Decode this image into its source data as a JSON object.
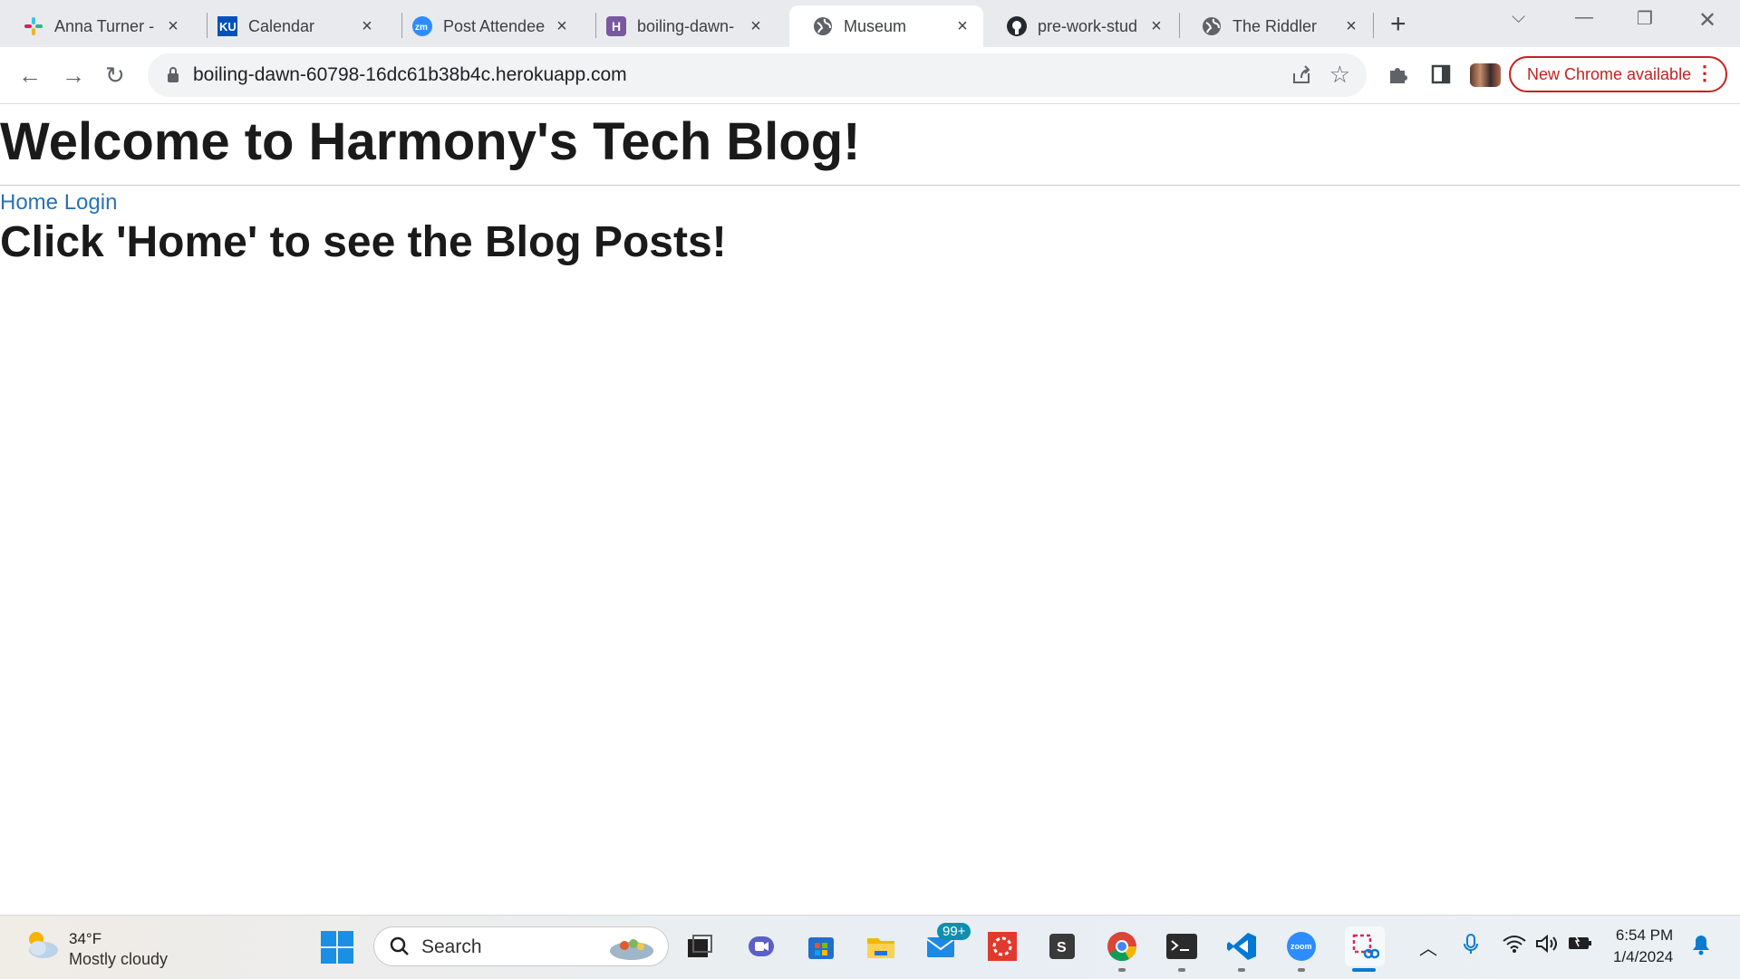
{
  "browser": {
    "tabs": [
      {
        "title": "Anna Turner -",
        "favicon": "slack-icon"
      },
      {
        "title": "Calendar",
        "favicon": "ku-icon"
      },
      {
        "title": "Post Attendee",
        "favicon": "zoom-icon"
      },
      {
        "title": "boiling-dawn-",
        "favicon": "heroku-icon"
      },
      {
        "title": "Museum",
        "favicon": "globe-icon",
        "active": true
      },
      {
        "title": "pre-work-stud",
        "favicon": "github-icon"
      },
      {
        "title": "The Riddler",
        "favicon": "globe-icon"
      }
    ],
    "url": "boiling-dawn-60798-16dc61b38b4c.herokuapp.com",
    "update_label": "New Chrome available"
  },
  "page": {
    "title": "Welcome to Harmony's Tech Blog!",
    "nav": [
      {
        "label": "Home"
      },
      {
        "label": "Login"
      }
    ],
    "prompt": "Click 'Home' to see the Blog Posts!"
  },
  "taskbar": {
    "weather": {
      "temp": "34°F",
      "condition": "Mostly cloudy"
    },
    "search_label": "Search",
    "mail_badge": "99+",
    "time": "6:54 PM",
    "date": "1/4/2024"
  },
  "colors": {
    "link": "#2a72b5",
    "update_accent": "#c5221f"
  }
}
